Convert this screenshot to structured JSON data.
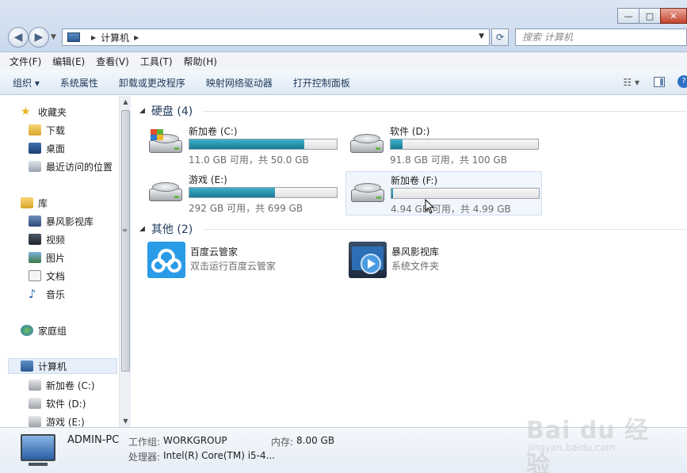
{
  "titlebar": {
    "minimize_glyph": "—",
    "maximize_glyph": "□",
    "close_glyph": "✕"
  },
  "address": {
    "path": "计算机",
    "search_placeholder": "搜索 计算机"
  },
  "menu": [
    "文件(F)",
    "编辑(E)",
    "查看(V)",
    "工具(T)",
    "帮助(H)"
  ],
  "commands": [
    "组织 ▾",
    "系统属性",
    "卸载或更改程序",
    "映射网络驱动器",
    "打开控制面板"
  ],
  "nav": {
    "favorites": "收藏夹",
    "downloads": "下载",
    "desktop": "桌面",
    "recent": "最近访问的位置",
    "libraries": "库",
    "storm_lib": "暴风影视库",
    "videos": "视频",
    "pictures": "图片",
    "documents": "文档",
    "music": "音乐",
    "homegroup": "家庭组",
    "computer": "计算机",
    "drive_c": "新加卷 (C:)",
    "drive_d": "软件 (D:)",
    "drive_e": "游戏 (E:)"
  },
  "groups": {
    "disks_header": "硬盘 (4)",
    "other_header": "其他 (2)"
  },
  "drives": [
    {
      "name": "新加卷 (C:)",
      "info": "11.0 GB 可用，共 50.0 GB",
      "used_fraction": 0.78
    },
    {
      "name": "软件 (D:)",
      "info": "91.8 GB 可用，共 100 GB",
      "used_fraction": 0.08
    },
    {
      "name": "游戏 (E:)",
      "info": "292 GB 可用，共 699 GB",
      "used_fraction": 0.58
    },
    {
      "name": "新加卷 (F:)",
      "info": "4.94 GB 可用，共 4.99 GB",
      "used_fraction": 0.01
    }
  ],
  "apps": [
    {
      "title": "百度云管家",
      "sub": "双击运行百度云管家",
      "color": "#2a9be6"
    },
    {
      "title": "暴风影视库",
      "sub": "系统文件夹",
      "color": "#2d6fb5"
    }
  ],
  "details": {
    "pc_name": "ADMIN-PC",
    "workgroup_label": "工作组:",
    "workgroup_value": "WORKGROUP",
    "memory_label": "内存:",
    "memory_value": "8.00 GB",
    "cpu_label": "处理器:",
    "cpu_value": "Intel(R) Core(TM) i5-4..."
  },
  "watermark": {
    "brand": "Bai du 经验",
    "url": "jingyan.baidu.com"
  }
}
